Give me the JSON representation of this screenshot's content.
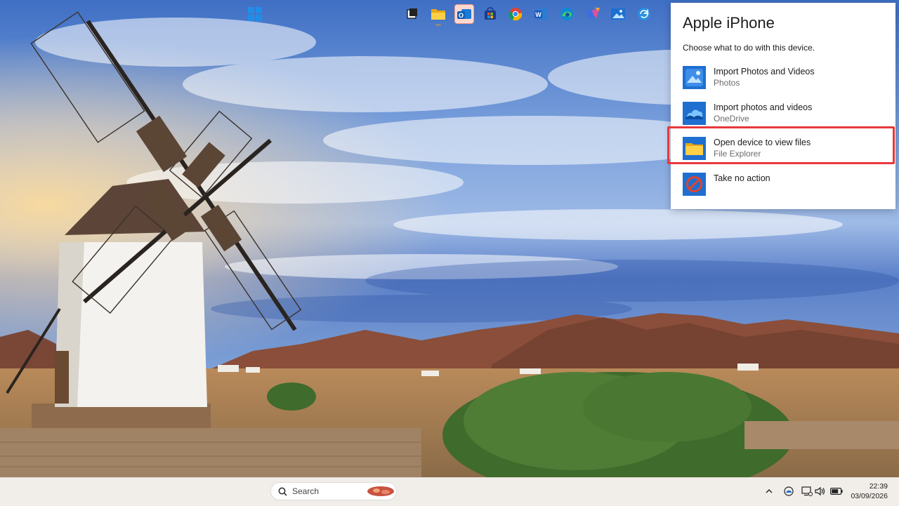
{
  "autoplay": {
    "title": "Apple iPhone",
    "subtitle": "Choose what to do with this device.",
    "options": [
      {
        "label": "Import Photos and Videos",
        "sub": "Photos",
        "icon": "photos-app-icon"
      },
      {
        "label": "Import photos and videos",
        "sub": "OneDrive",
        "icon": "onedrive-icon"
      },
      {
        "label": "Open device to view files",
        "sub": "File Explorer",
        "icon": "file-explorer-icon"
      },
      {
        "label": "Take no action",
        "sub": "",
        "icon": "no-action-icon"
      }
    ],
    "highlight_color": "#e8393b"
  },
  "taskbar": {
    "search_placeholder": "Search",
    "apps": [
      "start-icon",
      "task-view-icon",
      "file-explorer-icon",
      "outlook-icon",
      "microsoft-store-icon",
      "chrome-icon",
      "word-icon",
      "edge-icon",
      "copilot-icon",
      "photos-icon",
      "sync-icon"
    ],
    "tray": [
      "chevron-up-icon",
      "onedrive-tray-icon",
      "network-icon",
      "volume-icon",
      "battery-icon"
    ],
    "time": "22:39",
    "date": "03/09/2026"
  },
  "colors": {
    "accent": "#0067c0",
    "taskbar_bg": "#f1eeea"
  }
}
